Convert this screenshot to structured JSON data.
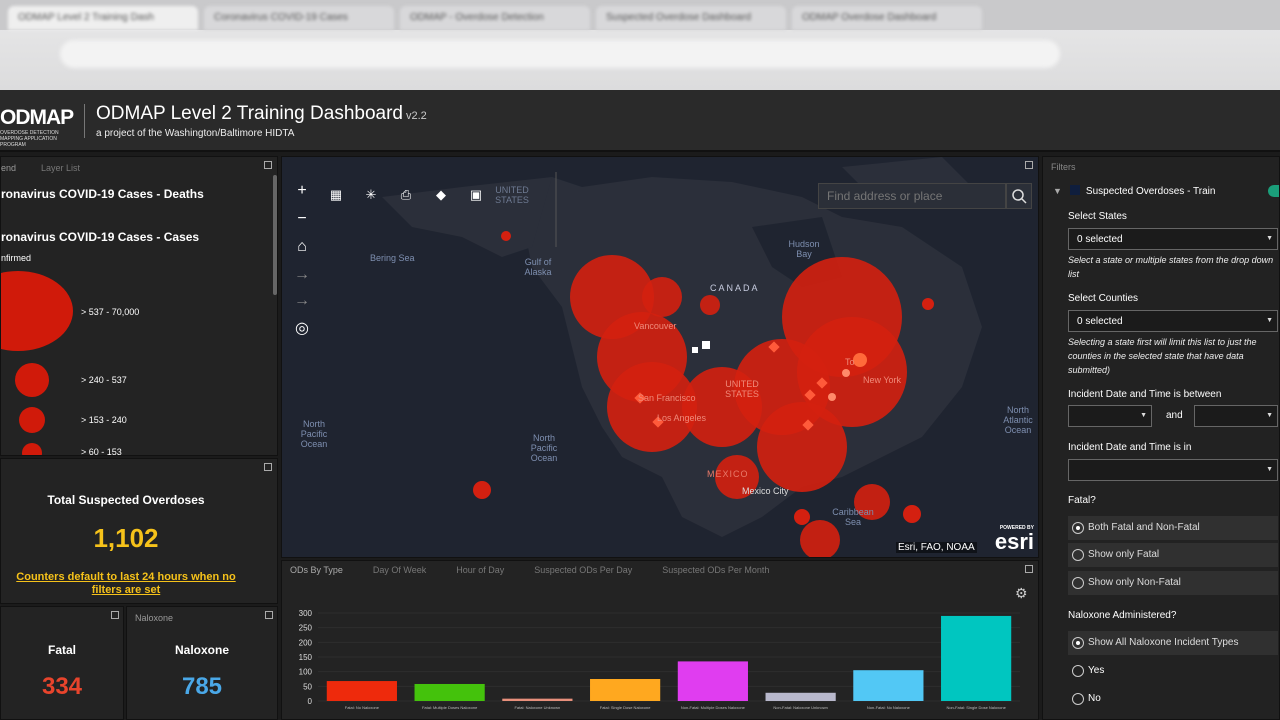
{
  "browser": {
    "tabs": [
      "ODMAP Level 2 Training Dash",
      "Coronavirus COVID-19 Cases",
      "ODMAP - Overdose Detection",
      "Suspected Overdose Dashboard",
      "ODMAP Overdose Dashboard"
    ]
  },
  "header": {
    "logo_text": "ODMAP",
    "logo_sub": "OVERDOSE DETECTION MAPPING APPLICATION PROGRAM",
    "title": "ODMAP Level 2 Training Dashboard",
    "version": "v2.2",
    "subtitle": "a project of the Washington/Baltimore HIDTA"
  },
  "legend": {
    "tabs": [
      "end",
      "Layer List"
    ],
    "layer1": "ronavirus COVID-19 Cases - Deaths",
    "layer2": "ronavirus COVID-19 Cases - Cases",
    "field": "nfirmed",
    "classes": [
      "> 537 - 70,000",
      "> 240 - 537",
      "> 153 - 240",
      "> 60 - 153"
    ]
  },
  "total": {
    "label": "Total Suspected Overdoses",
    "value": "1,102",
    "note": "Counters default to last 24 hours when no filters are set"
  },
  "fatal": {
    "tab": "",
    "label": "Fatal",
    "value": "334",
    "color": "#e8442c"
  },
  "naloxone": {
    "tab": "Naloxone",
    "label": "Naloxone",
    "value": "785",
    "color": "#4aa8e8"
  },
  "map": {
    "search_placeholder": "Find address or place",
    "labels": {
      "bering": "Bering Sea",
      "gulf": "Gulf of Alaska",
      "hudson": "Hudson Bay",
      "canada": "CANADA",
      "us": "UNITED STATES",
      "us_top": "UNITED STATES",
      "npo": "North Pacific Ocean",
      "npo2": "North Pacific Ocean",
      "nao": "North Atlantic Ocean",
      "mexico": "MEXICO",
      "mexico_city": "Mexico City",
      "caribbean": "Caribbean Sea",
      "vancouver": "Vancouver",
      "sf": "San Francisco",
      "la": "Los Angeles",
      "toronto": "To",
      "ny": "New York"
    },
    "attribution": "Esri, FAO, NOAA",
    "esri_powered": "POWERED BY",
    "esri": "esri",
    "tools": [
      "zoom-in",
      "zoom-out",
      "home",
      "back",
      "forward",
      "locate",
      "basemap-gallery",
      "measure",
      "print",
      "share",
      "bookmarks"
    ]
  },
  "chart": {
    "tabs": [
      "ODs By Type",
      "Day Of Week",
      "Hour of Day",
      "Suspected ODs Per Day",
      "Suspected ODs Per Month"
    ],
    "active_tab": 0
  },
  "chart_data": {
    "type": "bar",
    "categories": [
      "Fatal: No Naloxone",
      "Fatal: Multiple Doses Naloxone",
      "Fatal: Naloxone Unknown",
      "Fatal: Single Dose Naloxone",
      "Non-Fatal: Multiple Doses Naloxone",
      "Non-Fatal: Naloxone Unknown",
      "Non-Fatal: No Naloxone",
      "Non-Fatal: Single Dose Naloxone"
    ],
    "values": [
      68,
      58,
      8,
      75,
      135,
      28,
      105,
      290
    ],
    "colors": [
      "#ee2a0c",
      "#44c20c",
      "#e8907c",
      "#ffa81f",
      "#e03df0",
      "#b8b8cc",
      "#52c8f5",
      "#00c6c0"
    ],
    "yticks": [
      0,
      50,
      100,
      150,
      200,
      250,
      300
    ],
    "ylim": [
      0,
      300
    ]
  },
  "filters": {
    "title": "Filters",
    "layer": "Suspected Overdoses - Train",
    "states_label": "Select States",
    "states_value": "0 selected",
    "states_help": "Select a state or multiple states from the drop down list",
    "counties_label": "Select Counties",
    "counties_value": "0 selected",
    "counties_help": "Selecting a state first will limit this list to just the counties in the selected state that have data submitted)",
    "between_label": "Incident Date and Time is between",
    "and": "and",
    "in_label": "Incident Date and Time is in",
    "fatal_label": "Fatal?",
    "fatal_options": [
      "Both Fatal and Non-Fatal",
      "Show only Fatal",
      "Show only Non-Fatal"
    ],
    "naloxone_label": "Naloxone Administered?",
    "naloxone_options": [
      "Show All Naloxone Incident Types",
      "Yes",
      "No"
    ]
  }
}
